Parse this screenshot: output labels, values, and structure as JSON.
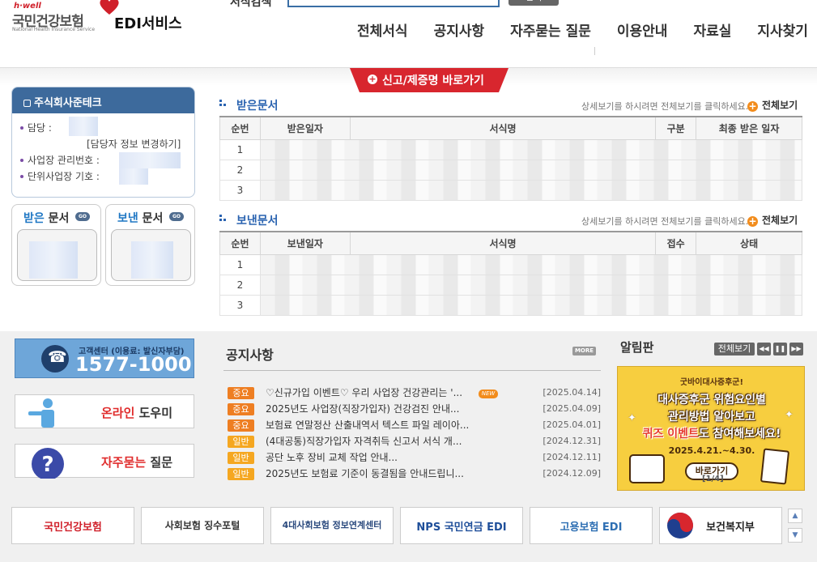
{
  "header": {
    "logo": {
      "hwell": "h·well",
      "name": "국민건강보험",
      "sub": "National Health Insurance Service",
      "service": "EDI서비스"
    },
    "search": {
      "label": "서식검색",
      "button": "검색",
      "value": ""
    },
    "nav": [
      "전체서식",
      "공지사항",
      "자주묻는 질문",
      "이용안내",
      "자료실",
      "지사찾기"
    ],
    "report_tab": "신고/제증명 바로가기"
  },
  "company": {
    "name": "주식회사준테크",
    "manager_label": "담당 :",
    "change_info": "[담당자 정보 변경하기]",
    "biz_no_label": "사업장 관리번호 :",
    "unit_symbol_label": "단위사업장 기호 :"
  },
  "mini_boxes": {
    "received": {
      "accent": "받은",
      "rest": " 문서",
      "go": "GO"
    },
    "sent": {
      "accent": "보낸",
      "rest": " 문서",
      "go": "GO"
    }
  },
  "received_docs": {
    "title": "받은문서",
    "hint": "상세보기를 하시려면 전체보기를 클릭하세요.",
    "view_all": "전체보기",
    "columns": [
      "순번",
      "받은일자",
      "서식명",
      "구분",
      "최종 받은 일자"
    ],
    "rows": [
      [
        "1"
      ],
      [
        "2"
      ],
      [
        "3"
      ]
    ]
  },
  "sent_docs": {
    "title": "보낸문서",
    "hint": "상세보기를 하시려면 전체보기를 클릭하세요.",
    "view_all": "전체보기",
    "columns": [
      "순번",
      "보낸일자",
      "서식명",
      "접수",
      "상태"
    ],
    "rows": [
      [
        "1"
      ],
      [
        "2"
      ],
      [
        "3"
      ]
    ]
  },
  "customer_center": {
    "label": "고객센터 (이용료: 발신자부담)",
    "number": "1577-1000"
  },
  "side_banners": {
    "online": {
      "accent": "온라인",
      "rest": " 도우미"
    },
    "faq": {
      "accent": "자주묻는",
      "rest": " 질문"
    }
  },
  "notice": {
    "title": "공지사항",
    "more": "MORE",
    "new_badge": "NEW",
    "items": [
      {
        "type": "중요",
        "kind": "imp",
        "title": "♡신규가입 이벤트♡ 우리 사업장 건강관리는 '...",
        "date": "[2025.04.14]",
        "new": true
      },
      {
        "type": "중요",
        "kind": "imp",
        "title": "2025년도 사업장(직장가입자) 건강검진 안내...",
        "date": "[2025.04.09]"
      },
      {
        "type": "중요",
        "kind": "imp",
        "title": "보험료 연말정산 산출내역서 텍스트 파일 레이아...",
        "date": "[2025.04.01]"
      },
      {
        "type": "일반",
        "kind": "gen",
        "title": "(4대공통)직장가입자 자격취득 신고서 서식 개...",
        "date": "[2024.12.31]"
      },
      {
        "type": "일반",
        "kind": "gen",
        "title": "공단 노후 장비 교체 작업 안내...",
        "date": "[2024.12.11]"
      },
      {
        "type": "일반",
        "kind": "gen",
        "title": "2025년도 보험료 기준이 동결됨을 안내드립니...",
        "date": "[2024.12.09]"
      }
    ]
  },
  "alarm": {
    "title": "알림판",
    "view_all": "전체보기",
    "popup": {
      "line1": "굿바이대사증후군!",
      "line2": "대사증후군 위험요인별",
      "line3": "관리방법 알아보고",
      "line4_accent": "퀴즈 이벤트",
      "line4_rest": "도 참여해보세요!",
      "period": "2025.4.21.~4.30.",
      "button": "바로가기",
      "page": "[1/4]"
    }
  },
  "footer_links": [
    {
      "label": "국민건강보험",
      "color": "#d0202a"
    },
    {
      "label": "사회보험 징수포털",
      "color": "#333333"
    },
    {
      "label": "4대사회보험 정보연계센터",
      "color": "#2b4a7e"
    },
    {
      "label": "NPS 국민연금 EDI",
      "color": "#1f4f9a"
    },
    {
      "label": "고용보험 EDI",
      "color": "#2e6fb3"
    },
    {
      "label": "보건복지부",
      "color": "#222222"
    }
  ]
}
